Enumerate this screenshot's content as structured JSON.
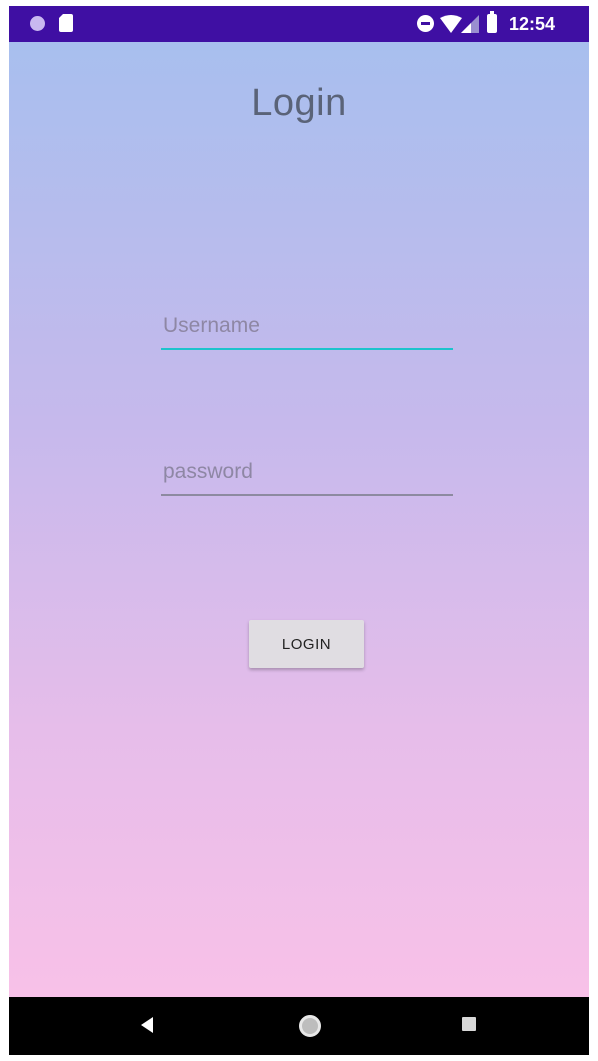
{
  "status_bar": {
    "time": "12:54",
    "icons": [
      "notification-dot-icon",
      "sd-card-icon",
      "do-not-disturb-icon",
      "wifi-icon",
      "signal-icon",
      "battery-icon"
    ],
    "background": "#3f0fa3"
  },
  "screen": {
    "title": "Login"
  },
  "form": {
    "username": {
      "placeholder": "Username",
      "value": "",
      "focused": true
    },
    "password": {
      "placeholder": "password",
      "value": ""
    },
    "login_label": "LOGIN"
  },
  "nav_bar": {
    "icons": [
      "back-icon",
      "home-icon",
      "recents-icon"
    ]
  },
  "colors": {
    "accent": "#1cc3cc",
    "gradient_top": "#a8bfee",
    "gradient_bottom": "#f8c1e8"
  }
}
